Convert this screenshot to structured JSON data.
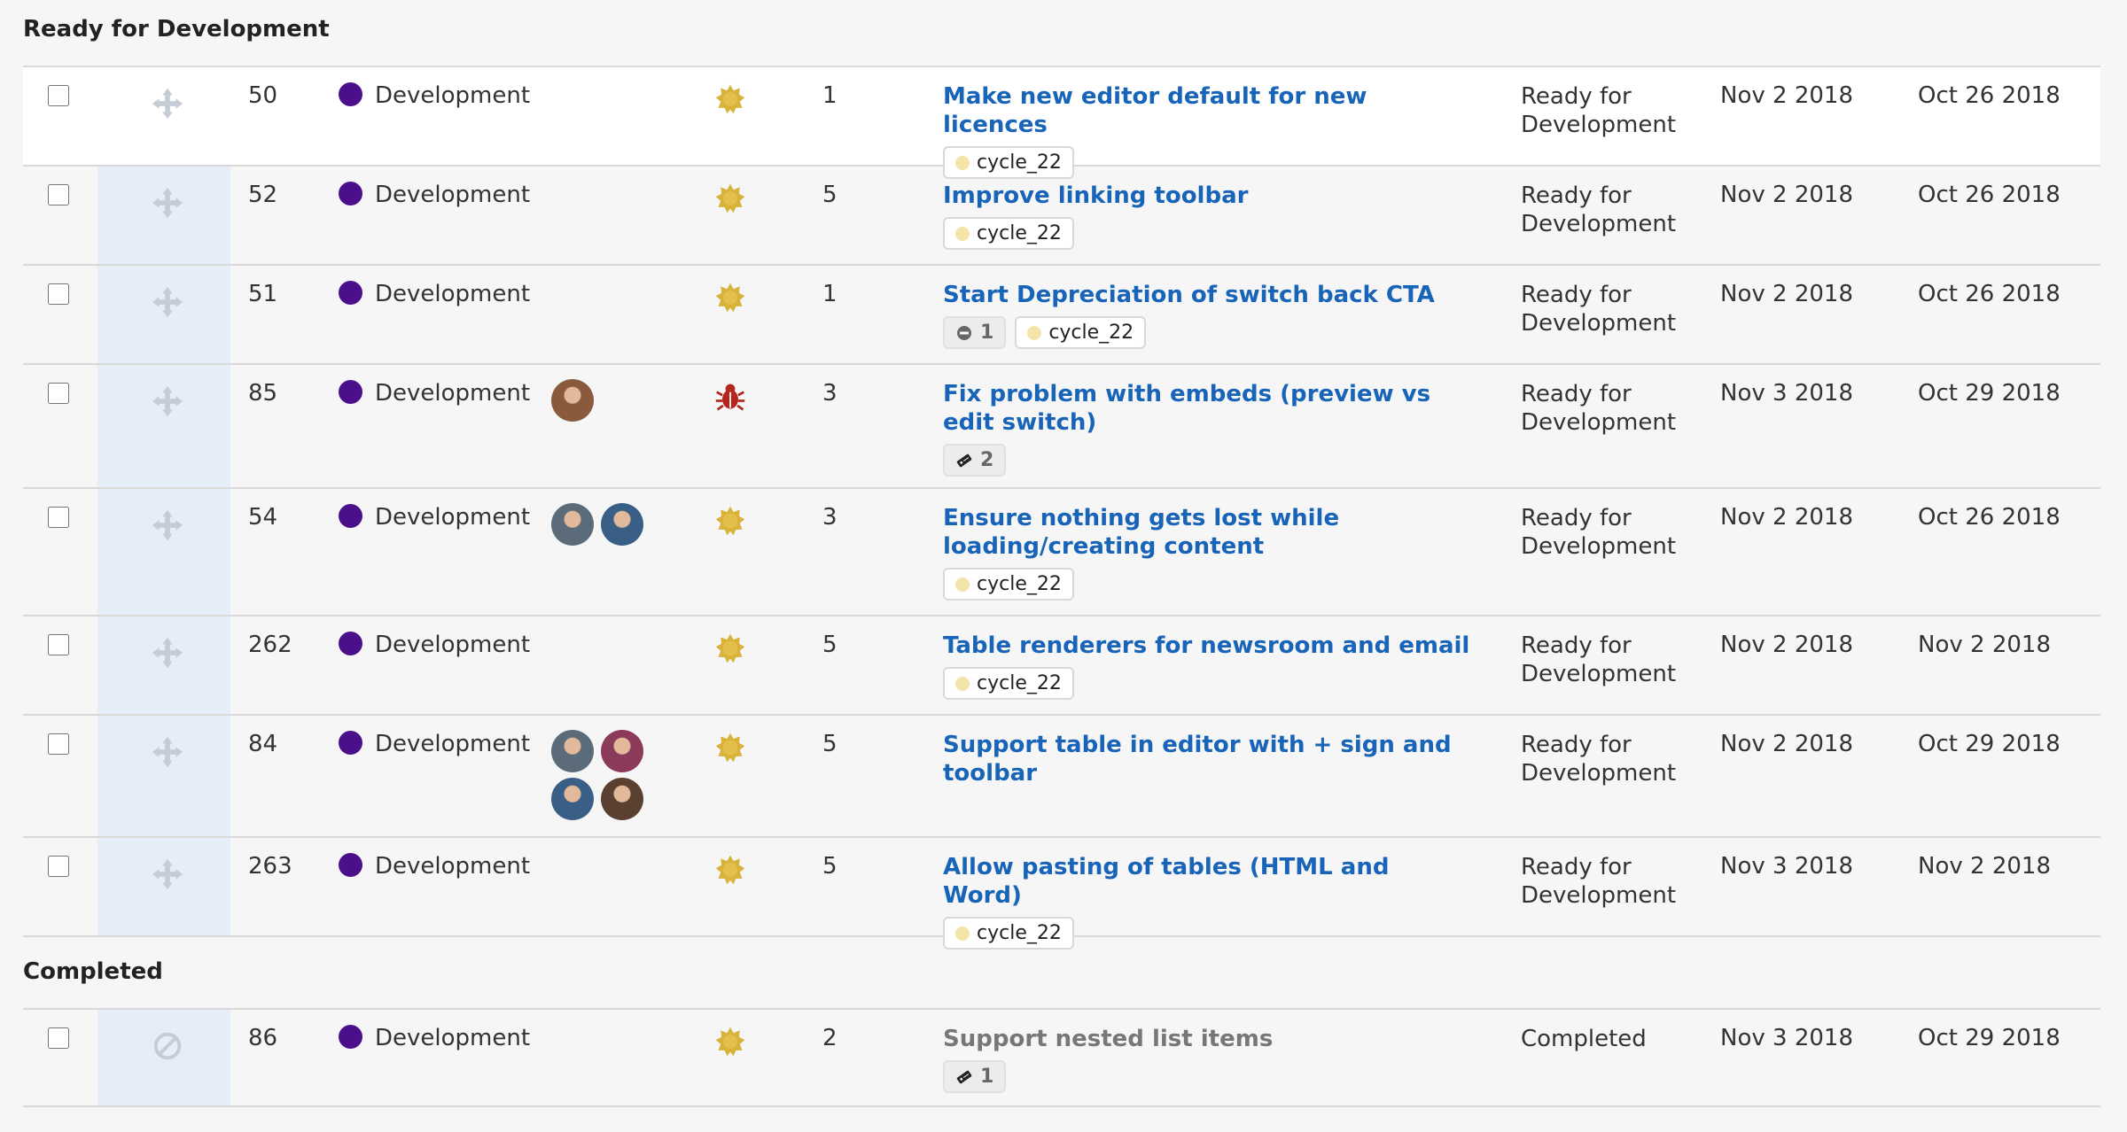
{
  "groups": [
    {
      "title": "Ready for Development",
      "rows": [
        {
          "id": "50",
          "type": "Development",
          "avatars": [],
          "kind": "feature",
          "points": "1",
          "title": "Make new editor default for new licences",
          "chips": [
            {
              "style": "label",
              "text": "cycle_22"
            }
          ],
          "status": "Ready for Development",
          "due": "Nov 2 2018",
          "created": "Oct 26 2018"
        },
        {
          "id": "52",
          "type": "Development",
          "avatars": [],
          "kind": "feature",
          "points": "5",
          "title": "Improve linking toolbar",
          "chips": [
            {
              "style": "label",
              "text": "cycle_22"
            }
          ],
          "status": "Ready for Development",
          "due": "Nov 2 2018",
          "created": "Oct 26 2018"
        },
        {
          "id": "51",
          "type": "Development",
          "avatars": [],
          "kind": "feature",
          "points": "1",
          "title": "Start Depreciation of switch back CTA",
          "chips": [
            {
              "style": "blocked",
              "text": "1"
            },
            {
              "style": "label",
              "text": "cycle_22"
            }
          ],
          "status": "Ready for Development",
          "due": "Nov 2 2018",
          "created": "Oct 26 2018"
        },
        {
          "id": "85",
          "type": "Development",
          "avatars": [
            "#8a5a3c"
          ],
          "kind": "bug",
          "points": "3",
          "title": "Fix problem with embeds (preview vs edit switch)",
          "chips": [
            {
              "style": "tasks",
              "text": "2"
            }
          ],
          "status": "Ready for Development",
          "due": "Nov 3 2018",
          "created": "Oct 29 2018"
        },
        {
          "id": "54",
          "type": "Development",
          "avatars": [
            "#5b6b7a",
            "#3a5f86"
          ],
          "kind": "feature",
          "points": "3",
          "title": "Ensure nothing gets lost while loading/creating content",
          "chips": [
            {
              "style": "label",
              "text": "cycle_22"
            }
          ],
          "status": "Ready for Development",
          "due": "Nov 2 2018",
          "created": "Oct 26 2018"
        },
        {
          "id": "262",
          "type": "Development",
          "avatars": [],
          "kind": "feature",
          "points": "5",
          "title": "Table renderers for newsroom and email",
          "chips": [
            {
              "style": "label",
              "text": "cycle_22"
            }
          ],
          "status": "Ready for Development",
          "due": "Nov 2 2018",
          "created": "Nov 2 2018"
        },
        {
          "id": "84",
          "type": "Development",
          "avatars": [
            "#5b6b7a",
            "#8b3a5a",
            "#3a5f86",
            "#5a4030"
          ],
          "kind": "feature",
          "points": "5",
          "title": "Support table in editor with + sign and toolbar",
          "chips": [],
          "status": "Ready for Development",
          "due": "Nov 2 2018",
          "created": "Oct 29 2018"
        },
        {
          "id": "263",
          "type": "Development",
          "avatars": [],
          "kind": "feature",
          "points": "5",
          "title": "Allow pasting of tables (HTML and Word)",
          "chips": [
            {
              "style": "label",
              "text": "cycle_22"
            }
          ],
          "status": "Ready for Development",
          "due": "Nov 3 2018",
          "created": "Nov 2 2018"
        }
      ]
    },
    {
      "title": "Completed",
      "rows": [
        {
          "id": "86",
          "type": "Development",
          "avatars": [],
          "kind": "feature",
          "points": "2",
          "title": "Support nested list items",
          "chips": [
            {
              "style": "tasks",
              "text": "1"
            }
          ],
          "status": "Completed",
          "due": "Nov 3 2018",
          "created": "Oct 29 2018",
          "done": true
        }
      ]
    }
  ],
  "icons": {
    "feature": "sun-badge-icon",
    "bug": "bug-icon",
    "drag": "move-handle-icon",
    "disabled": "not-allowed-icon"
  },
  "colors": {
    "link": "#1864b8",
    "type_dot": "#4b0f8c",
    "feature_icon": "#d9b23a",
    "bug_icon": "#b3261e",
    "label_dot": "#f3e4a8",
    "handle_column": "#e5eef8"
  }
}
